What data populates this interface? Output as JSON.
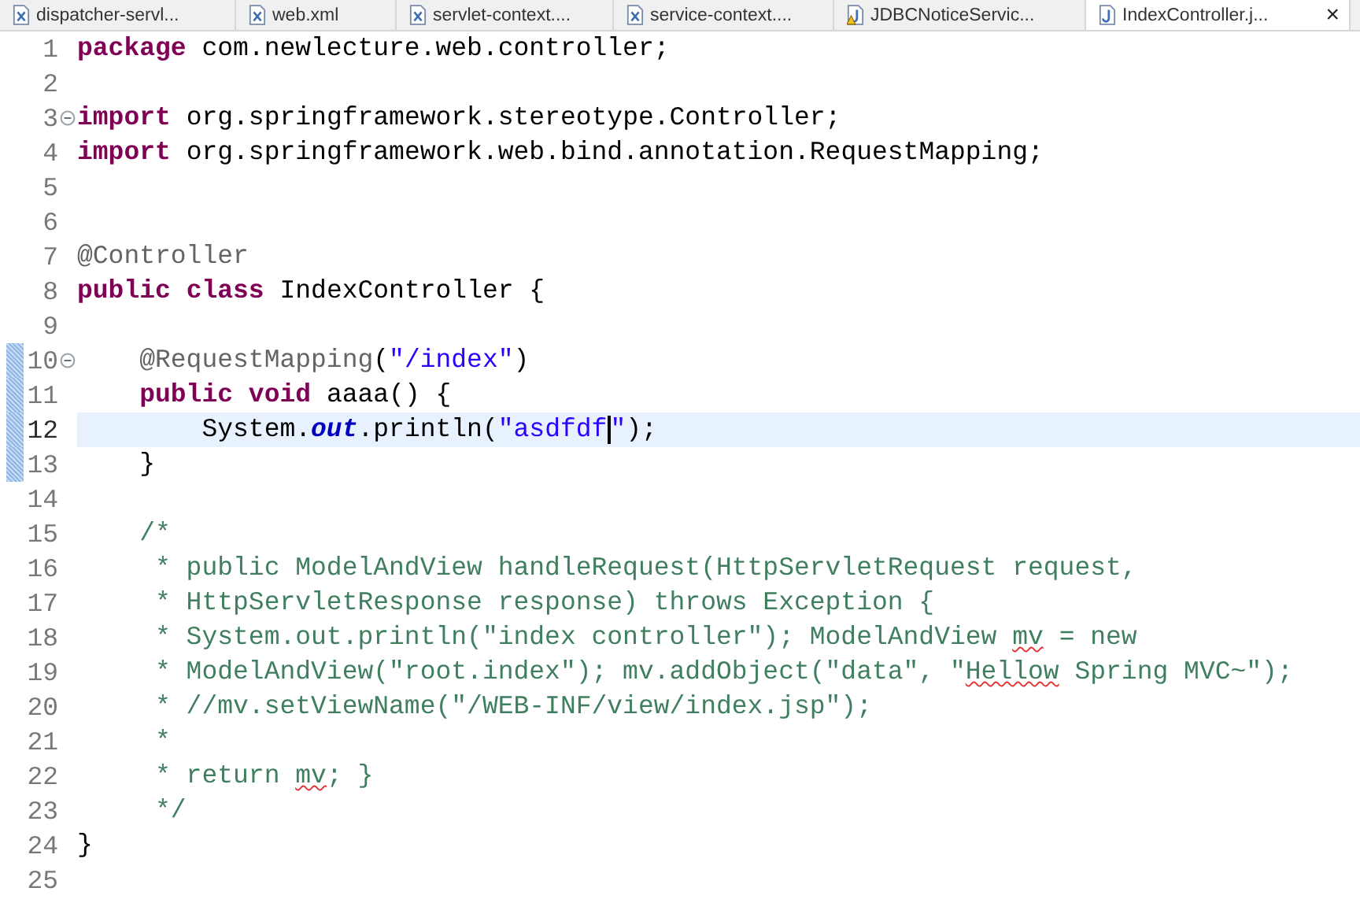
{
  "tabs": [
    {
      "label": "dispatcher-servl...",
      "kind": "xml",
      "selected": false
    },
    {
      "label": "web.xml",
      "kind": "xml",
      "selected": false
    },
    {
      "label": "servlet-context....",
      "kind": "xml",
      "selected": false
    },
    {
      "label": "service-context....",
      "kind": "xml",
      "selected": false
    },
    {
      "label": "JDBCNoticeServic...",
      "kind": "java-warning",
      "selected": false
    },
    {
      "label": "IndexController.j...",
      "kind": "java",
      "selected": true
    }
  ],
  "close": "×",
  "lines": [
    {
      "number": "1",
      "changed": false,
      "foldable": false,
      "current": false,
      "tokens": [
        {
          "kind": "keyword",
          "text": "package"
        },
        {
          "kind": "plain",
          "text": " com.newlecture.web.controller;"
        }
      ]
    },
    {
      "number": "2",
      "changed": false,
      "foldable": false,
      "current": false
    },
    {
      "number": "3",
      "changed": false,
      "foldable": true,
      "current": false,
      "tokens": [
        {
          "kind": "keyword",
          "text": "import"
        },
        {
          "kind": "plain",
          "text": " org.springframework.stereotype.Controller;"
        }
      ]
    },
    {
      "number": "4",
      "changed": false,
      "foldable": false,
      "current": false,
      "tokens": [
        {
          "kind": "keyword",
          "text": "import"
        },
        {
          "kind": "plain",
          "text": " org.springframework.web.bind.annotation.RequestMapping;"
        }
      ]
    },
    {
      "number": "5",
      "changed": false,
      "foldable": false,
      "current": false
    },
    {
      "number": "6",
      "changed": false,
      "foldable": false,
      "current": false
    },
    {
      "number": "7",
      "changed": false,
      "foldable": false,
      "current": false,
      "tokens": [
        {
          "kind": "annotation",
          "text": "@Controller"
        }
      ]
    },
    {
      "number": "8",
      "changed": false,
      "foldable": false,
      "current": false,
      "tokens": [
        {
          "kind": "keyword",
          "text": "public"
        },
        {
          "kind": "keyword",
          "text": " class"
        },
        {
          "kind": "plain",
          "text": " IndexController {"
        }
      ]
    },
    {
      "number": "9",
      "changed": false,
      "foldable": false,
      "current": false
    },
    {
      "number": "10",
      "changed": true,
      "foldable": true,
      "current": false,
      "tokens": [
        {
          "kind": "annotation",
          "text": "    @RequestMapping"
        },
        {
          "kind": "plain",
          "text": "("
        },
        {
          "kind": "string",
          "text": "\"/index\""
        },
        {
          "kind": "plain",
          "text": ")"
        }
      ]
    },
    {
      "number": "11",
      "changed": true,
      "foldable": false,
      "current": false,
      "tokens": [
        {
          "kind": "keyword",
          "text": "    public"
        },
        {
          "kind": "keyword",
          "text": " void"
        },
        {
          "kind": "plain",
          "text": " aaaa() {"
        }
      ]
    },
    {
      "number": "12",
      "changed": true,
      "foldable": false,
      "current": true,
      "tokens": [
        {
          "kind": "plain",
          "text": "        System."
        },
        {
          "kind": "field",
          "text": "out"
        },
        {
          "kind": "plain",
          "text": ".println("
        },
        {
          "kind": "string",
          "text": "\"asdfdf"
        },
        {
          "kind": "caret"
        },
        {
          "kind": "string",
          "text": "\""
        },
        {
          "kind": "plain",
          "text": ");"
        }
      ]
    },
    {
      "number": "13",
      "changed": true,
      "foldable": false,
      "current": false,
      "tokens": [
        {
          "kind": "plain",
          "text": "    }"
        }
      ]
    },
    {
      "number": "14",
      "changed": false,
      "foldable": false,
      "current": false
    },
    {
      "number": "15",
      "changed": false,
      "foldable": false,
      "current": false,
      "tokens": [
        {
          "kind": "comment",
          "text": "    /*"
        }
      ]
    },
    {
      "number": "16",
      "changed": false,
      "foldable": false,
      "current": false,
      "tokens": [
        {
          "kind": "comment",
          "text": "     * public ModelAndView handleRequest(HttpServletRequest request,"
        }
      ]
    },
    {
      "number": "17",
      "changed": false,
      "foldable": false,
      "current": false,
      "tokens": [
        {
          "kind": "comment",
          "text": "     * HttpServletResponse response) throws Exception {"
        }
      ]
    },
    {
      "number": "18",
      "changed": false,
      "foldable": false,
      "current": false,
      "tokens": [
        {
          "kind": "comment",
          "text": "     * System.out.println(\"index controller\"); ModelAndView "
        },
        {
          "kind": "comment_misspelled",
          "text": "mv"
        },
        {
          "kind": "comment",
          "text": " = new"
        }
      ]
    },
    {
      "number": "19",
      "changed": false,
      "foldable": false,
      "current": false,
      "tokens": [
        {
          "kind": "comment",
          "text": "     * ModelAndView(\"root.index\"); mv.addObject(\"data\", \""
        },
        {
          "kind": "comment_misspelled",
          "text": "Hellow"
        },
        {
          "kind": "comment",
          "text": " Spring MVC~\");"
        }
      ]
    },
    {
      "number": "20",
      "changed": false,
      "foldable": false,
      "current": false,
      "tokens": [
        {
          "kind": "comment",
          "text": "     * //mv.setViewName(\"/WEB-INF/view/index.jsp\");"
        }
      ]
    },
    {
      "number": "21",
      "changed": false,
      "foldable": false,
      "current": false,
      "tokens": [
        {
          "kind": "comment",
          "text": "     *"
        }
      ]
    },
    {
      "number": "22",
      "changed": false,
      "foldable": false,
      "current": false,
      "tokens": [
        {
          "kind": "comment",
          "text": "     * return "
        },
        {
          "kind": "comment_misspelled",
          "text": "mv"
        },
        {
          "kind": "comment",
          "text": "; }"
        }
      ]
    },
    {
      "number": "23",
      "changed": false,
      "foldable": false,
      "current": false,
      "tokens": [
        {
          "kind": "comment",
          "text": "     */"
        }
      ]
    },
    {
      "number": "24",
      "changed": false,
      "foldable": false,
      "current": false,
      "tokens": [
        {
          "kind": "plain",
          "text": "}"
        }
      ]
    },
    {
      "number": "25",
      "changed": false,
      "foldable": false,
      "current": false
    }
  ]
}
